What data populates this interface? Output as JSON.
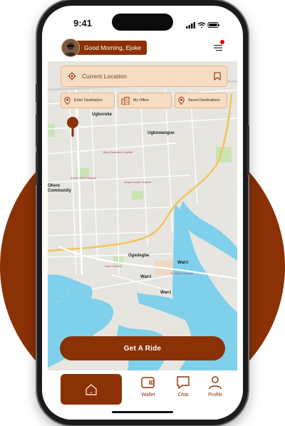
{
  "status": {
    "time": "9:41"
  },
  "header": {
    "greeting": "Good Morning, Ejoke"
  },
  "search": {
    "placeholder": "Current Location"
  },
  "quick_actions": [
    {
      "label": "Enter Destination",
      "icon": "pin-icon"
    },
    {
      "label": "My Office",
      "icon": "building-icon"
    },
    {
      "label": "Saved Destinations",
      "icon": "pin-icon"
    }
  ],
  "map": {
    "labels": {
      "ugboroke": "Ugboroke",
      "ugbuwangue": "Ugbuwangue",
      "okere_community": "Okere Community",
      "ogedegbe": "Ogedegbe",
      "warri_1": "Warri",
      "warri_2": "Warri",
      "warri_3": "Warri",
      "pink_1": "Baba Specialist Hospital",
      "pink_2": "Aminu Clinic Hospital",
      "pink_3": "Bright Health Hospital",
      "pink_4": "St. Mary's Hospital",
      "pink_5": "Warri Hospital"
    },
    "colors": {
      "water": "#7fd0ea",
      "road_major": "#f3c35a",
      "land": "#e7e5e0",
      "park": "#c9e4b5"
    }
  },
  "cta": {
    "label": "Get A Ride"
  },
  "bottom_nav": [
    {
      "label": "Wallet",
      "icon": "wallet-icon"
    },
    {
      "label": "Chat",
      "icon": "chat-icon"
    },
    {
      "label": "Profile",
      "icon": "profile-icon"
    }
  ],
  "colors": {
    "brand": "#8a3106",
    "chip_bg": "#f6dcc1"
  }
}
